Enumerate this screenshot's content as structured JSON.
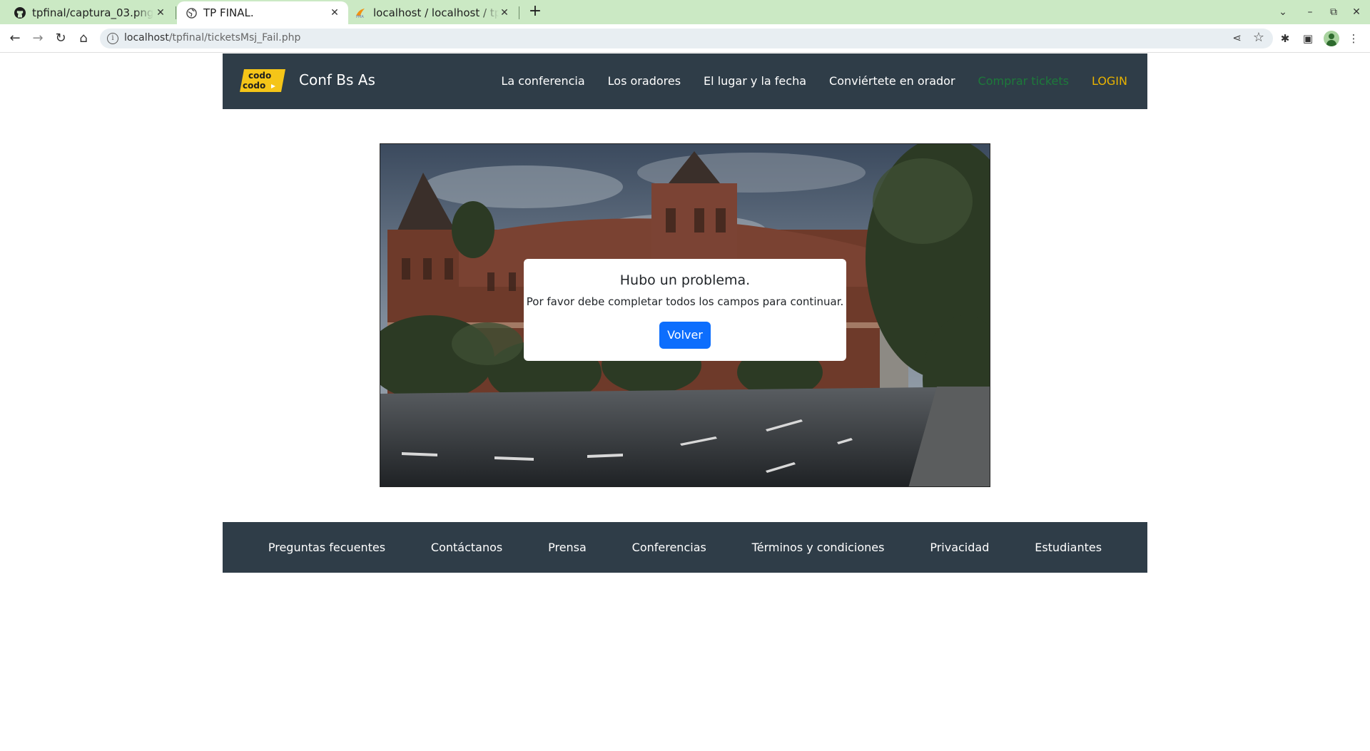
{
  "browser": {
    "tabs": [
      {
        "title": "tpfinal/captura_03.png at",
        "icon": "github-icon"
      },
      {
        "title": "TP FINAL.",
        "icon": "globe-icon",
        "active": true
      },
      {
        "title": "localhost / localhost / tp_fi",
        "icon": "phpmyadmin-icon"
      }
    ],
    "url_host": "localhost",
    "url_path": "/tpfinal/ticketsMsj_Fail.php"
  },
  "site": {
    "brand": "Conf Bs As",
    "logo_text_1": "codo",
    "logo_text_2": "codo",
    "nav": [
      {
        "label": "La conferencia"
      },
      {
        "label": "Los oradores"
      },
      {
        "label": "El lugar y la fecha"
      },
      {
        "label": "Conviértete en orador"
      },
      {
        "label": "Comprar tickets",
        "color": "#1d7a3a"
      },
      {
        "label": "LOGIN",
        "color": "#e9b300"
      }
    ],
    "colors": {
      "navbar": "#2f3d48",
      "primary_button": "#0d6efd"
    }
  },
  "modal": {
    "title": "Hubo un problema.",
    "message": "Por favor debe completar todos los campos para continuar.",
    "button": "Volver"
  },
  "footer": {
    "links": [
      "Preguntas fecuentes",
      "Contáctanos",
      "Prensa",
      "Conferencias",
      "Términos y condiciones",
      "Privacidad",
      "Estudiantes"
    ]
  }
}
